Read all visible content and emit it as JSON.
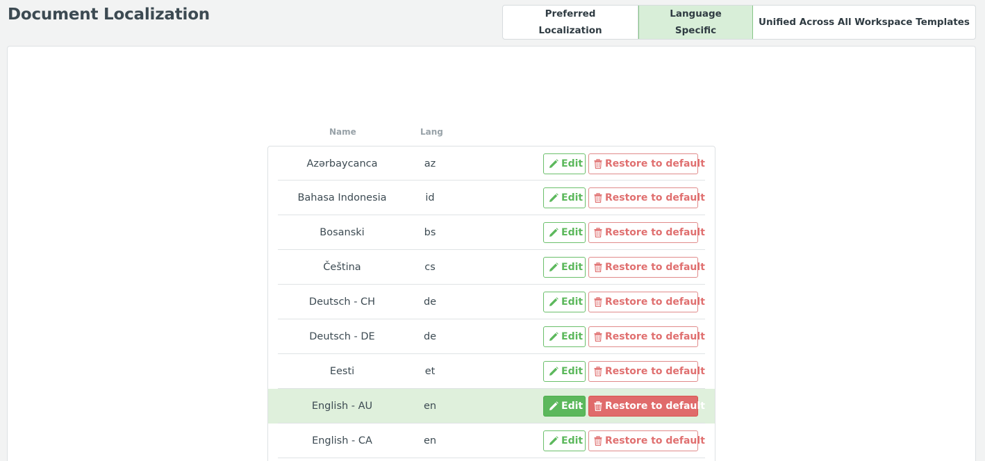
{
  "header": {
    "title": "Document Localization",
    "segments": [
      {
        "label": "Preferred\nLocalization"
      },
      {
        "label": "Language\nSpecific"
      },
      {
        "label": "Unified Across All Workspace Templates"
      }
    ],
    "active_segment": "Language Specific"
  },
  "table": {
    "columns": {
      "name": "Name",
      "lang": "Lang"
    },
    "edit_label": "Edit",
    "restore_label": "Restore to default",
    "rows": [
      {
        "name": "Azərbaycanca",
        "lang": "az"
      },
      {
        "name": "Bahasa Indonesia",
        "lang": "id"
      },
      {
        "name": "Bosanski",
        "lang": "bs"
      },
      {
        "name": "Čeština",
        "lang": "cs"
      },
      {
        "name": "Deutsch - CH",
        "lang": "de"
      },
      {
        "name": "Deutsch - DE",
        "lang": "de"
      },
      {
        "name": "Eesti",
        "lang": "et"
      },
      {
        "name": "English - AU",
        "lang": "en"
      },
      {
        "name": "English - CA",
        "lang": "en"
      }
    ],
    "selected_row": "English - AU"
  },
  "colors": {
    "active_segment_bg": "#d8eed8",
    "edit": "#5cb85c",
    "restore": "#e07070",
    "selected_row_bg": "#dff0dc"
  },
  "icons": {
    "edit": "pencil-icon",
    "restore": "trash-icon"
  }
}
